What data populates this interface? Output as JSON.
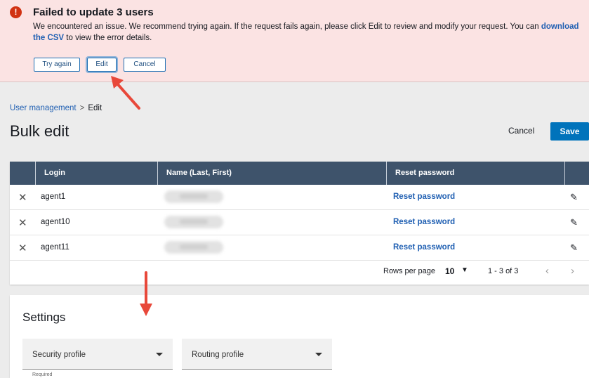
{
  "banner": {
    "icon": "exclamation-icon",
    "title": "Failed to update 3 users",
    "message_before": "We encountered an issue. We recommend trying again. If the request fails again, please click Edit to review and modify your request. You can",
    "link": "download the CSV",
    "message_after": "to view the error details.",
    "buttons": {
      "try_again": "Try again",
      "edit": "Edit",
      "cancel": "Cancel"
    }
  },
  "breadcrumb": {
    "parent": "User management",
    "separator": ">",
    "current": "Edit"
  },
  "page_title": "Bulk edit",
  "header_actions": {
    "cancel": "Cancel",
    "save": "Save"
  },
  "table": {
    "columns": [
      "Login",
      "Name (Last, First)",
      "Reset password"
    ],
    "rows": [
      {
        "login": "agent1",
        "reset": "Reset password"
      },
      {
        "login": "agent10",
        "reset": "Reset password"
      },
      {
        "login": "agent11",
        "reset": "Reset password"
      }
    ],
    "pager": {
      "rows_per_page_label": "Rows per page",
      "rows_per_page": "10",
      "range": "1 - 3 of 3"
    }
  },
  "settings": {
    "title": "Settings",
    "security_profile": "Security profile",
    "routing_profile": "Routing profile",
    "required": "Required"
  },
  "colors": {
    "error": "#d13212",
    "primary": "#0073bb",
    "link": "#1f5fb2",
    "table_header": "#3e536b",
    "annotation": "#e8483a"
  }
}
